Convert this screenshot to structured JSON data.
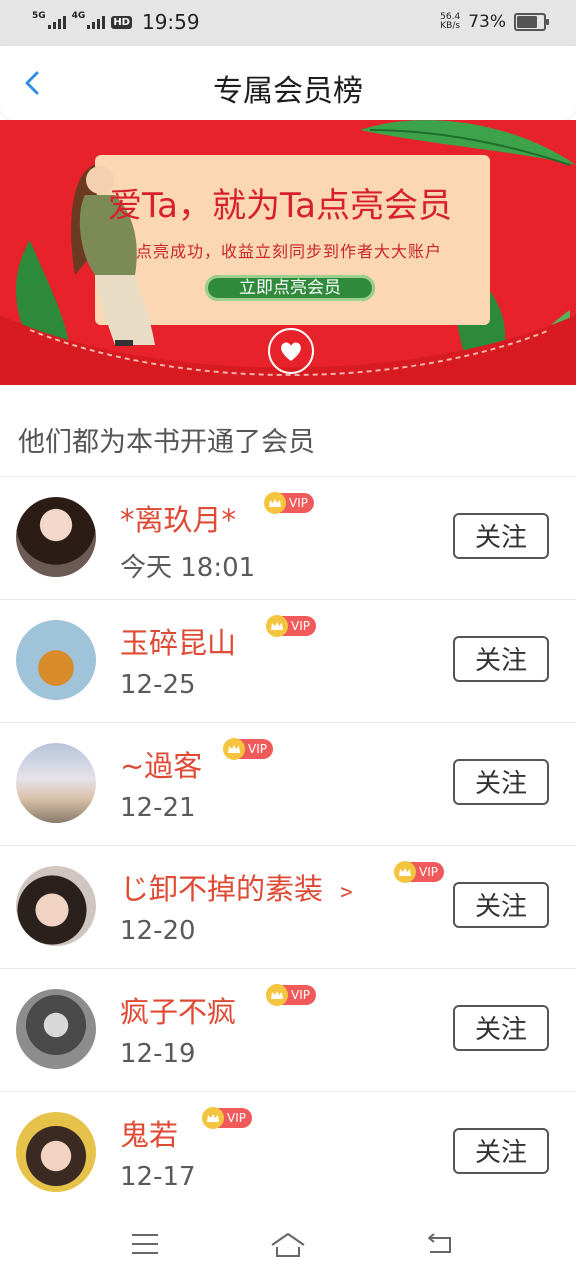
{
  "status_bar": {
    "network1": "5G",
    "network2": "4G",
    "hd": "HD",
    "time": "19:59",
    "speed_value": "56.4",
    "speed_unit": "KB/s",
    "battery_text": "73%",
    "battery_level": 0.73
  },
  "header": {
    "title": "专属会员榜"
  },
  "banner": {
    "title": "爱Ta，就为Ta点亮会员",
    "subtitle": "点亮成功，收益立刻同步到作者大大账户",
    "button_label": "立即点亮会员"
  },
  "section": {
    "title": "他们都为本书开通了会员"
  },
  "vip_label": "VIP",
  "follow_label": "关注",
  "members": [
    {
      "name": "*离玖月*",
      "date": "今天  18:01"
    },
    {
      "name": "玉碎昆山",
      "date": "12-25"
    },
    {
      "name": "~過客",
      "date": "12-21"
    },
    {
      "name": "じ卸不掉的素装 ﹥",
      "date": "12-20"
    },
    {
      "name": "疯子不疯",
      "date": "12-19"
    },
    {
      "name": "鬼若",
      "date": "12-17"
    }
  ],
  "colors": {
    "accent_red": "#df4a34",
    "banner_red": "#e8222a",
    "vip_red": "#f05a5a",
    "crown_gold": "#f6c53f",
    "back_blue": "#2f8fe0"
  },
  "icons": {
    "back": "chevron-left-icon",
    "menu": "menu-icon",
    "home": "home-icon",
    "return": "back-arrow-icon"
  }
}
